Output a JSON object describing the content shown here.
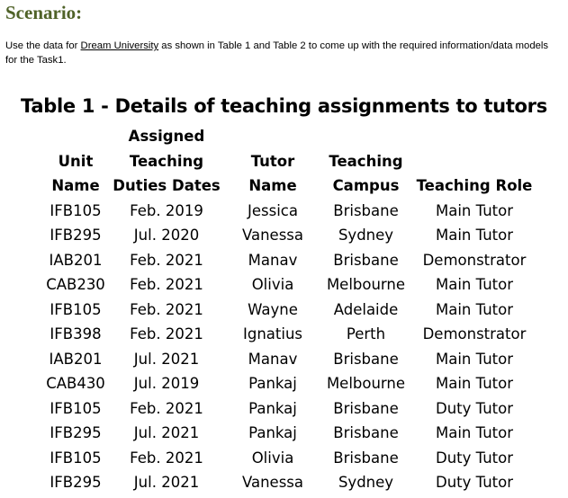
{
  "scenario": {
    "heading": "Scenario:",
    "intro_before": "Use the data for ",
    "intro_link": "Dream University",
    "intro_after": " as shown in Table 1 and Table 2 to come up with the required information/data models for the Task1."
  },
  "table": {
    "title": "Table 1 - Details of teaching assignments to tutors",
    "headers": [
      {
        "lines": [
          "",
          "Unit",
          "Name"
        ]
      },
      {
        "lines": [
          "Assigned",
          "Teaching",
          "Duties Dates"
        ]
      },
      {
        "lines": [
          "",
          "Tutor",
          "Name"
        ]
      },
      {
        "lines": [
          "",
          "Teaching",
          "Campus"
        ]
      },
      {
        "lines": [
          "",
          "",
          "Teaching Role"
        ]
      }
    ],
    "rows": [
      [
        "IFB105",
        "Feb. 2019",
        "Jessica",
        "Brisbane",
        "Main Tutor"
      ],
      [
        "IFB295",
        "Jul. 2020",
        "Vanessa",
        "Sydney",
        "Main Tutor"
      ],
      [
        "IAB201",
        "Feb. 2021",
        "Manav",
        "Brisbane",
        "Demonstrator"
      ],
      [
        "CAB230",
        "Feb. 2021",
        "Olivia",
        "Melbourne",
        "Main Tutor"
      ],
      [
        "IFB105",
        "Feb. 2021",
        "Wayne",
        "Adelaide",
        "Main Tutor"
      ],
      [
        "IFB398",
        "Feb. 2021",
        "Ignatius",
        "Perth",
        "Demonstrator"
      ],
      [
        "IAB201",
        "Jul. 2021",
        "Manav",
        "Brisbane",
        "Main Tutor"
      ],
      [
        "CAB430",
        "Jul. 2019",
        "Pankaj",
        "Melbourne",
        "Main Tutor"
      ],
      [
        "IFB105",
        "Feb. 2021",
        "Pankaj",
        "Brisbane",
        "Duty Tutor"
      ],
      [
        "IFB295",
        "Jul. 2021",
        "Pankaj",
        "Brisbane",
        "Main Tutor"
      ],
      [
        "IFB105",
        "Feb. 2021",
        "Olivia",
        "Brisbane",
        "Duty Tutor"
      ],
      [
        "IFB295",
        "Jul. 2021",
        "Vanessa",
        "Sydney",
        "Duty Tutor"
      ]
    ]
  }
}
